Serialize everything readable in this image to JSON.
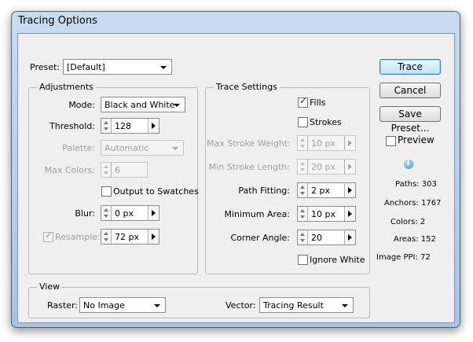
{
  "window": {
    "title": "Tracing Options"
  },
  "preset": {
    "label": "Preset:",
    "value": "[Default]"
  },
  "adjustments": {
    "title": "Adjustments",
    "mode": {
      "label": "Mode:",
      "value": "Black and White"
    },
    "threshold": {
      "label": "Threshold:",
      "value": "128"
    },
    "palette": {
      "label": "Palette:",
      "value": "Automatic"
    },
    "max_colors": {
      "label": "Max Colors:",
      "value": "6"
    },
    "output_to_swatches": {
      "label": "Output to Swatches",
      "checked": false
    },
    "blur": {
      "label": "Blur:",
      "value": "0 px"
    },
    "resample": {
      "label": "Resample:",
      "value": "72 px",
      "checked": true
    }
  },
  "trace_settings": {
    "title": "Trace Settings",
    "fills": {
      "label": "Fills",
      "checked": true
    },
    "strokes": {
      "label": "Strokes",
      "checked": false
    },
    "max_stroke_weight": {
      "label": "Max Stroke Weight:",
      "value": "10 px"
    },
    "min_stroke_length": {
      "label": "Min Stroke Length:",
      "value": "20 px"
    },
    "path_fitting": {
      "label": "Path Fitting:",
      "value": "2 px"
    },
    "minimum_area": {
      "label": "Minimum Area:",
      "value": "10 px"
    },
    "corner_angle": {
      "label": "Corner Angle:",
      "value": "20"
    },
    "ignore_white": {
      "label": "Ignore White",
      "checked": false
    }
  },
  "view": {
    "title": "View",
    "raster": {
      "label": "Raster:",
      "value": "No Image"
    },
    "vector": {
      "label": "Vector:",
      "value": "Tracing Result"
    }
  },
  "buttons": {
    "trace": "Trace",
    "cancel": "Cancel",
    "save_preset": "Save Preset..."
  },
  "preview": {
    "label": "Preview",
    "checked": false
  },
  "info_icon": "info-icon",
  "stats": {
    "paths": "Paths: 303",
    "anchors": "Anchors: 1767",
    "colors": "Colors: 2",
    "areas": "Areas: 152",
    "image_ppi": "Image PPI: 72"
  }
}
